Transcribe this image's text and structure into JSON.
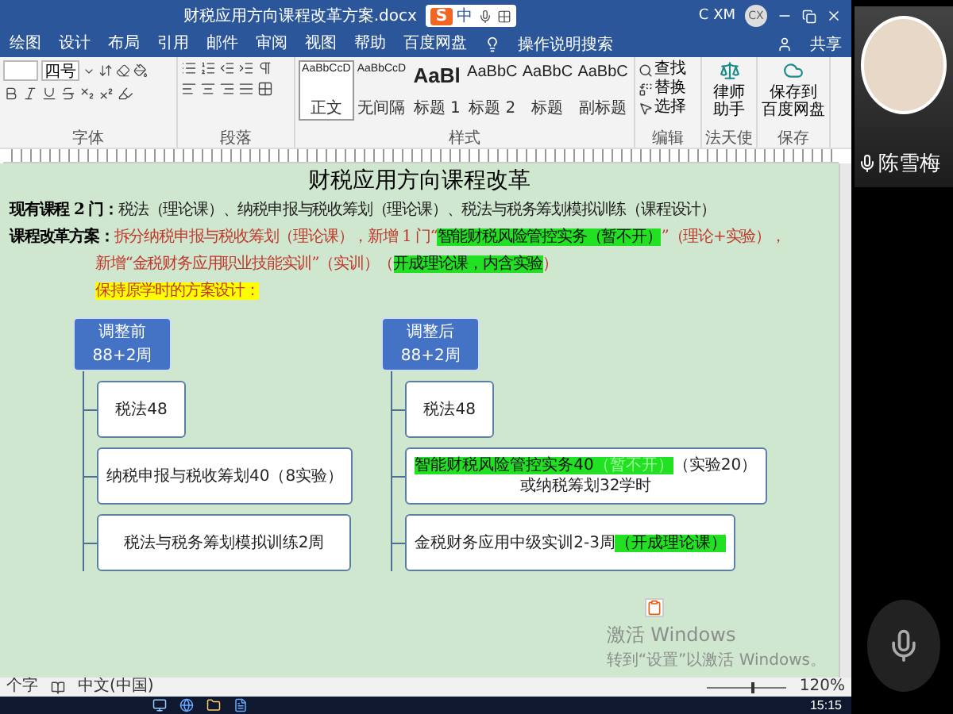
{
  "window": {
    "title": "财税应用方向课程改革方案.docx",
    "user": "C XM",
    "avatar": "CX"
  },
  "ime_toolbar": {
    "logo": "S",
    "mode": "中"
  },
  "menu": {
    "tabs": [
      {
        "label": "绘图",
        "selected": false
      },
      {
        "label": "设计",
        "selected": false
      },
      {
        "label": "布局",
        "selected": false
      },
      {
        "label": "引用",
        "selected": false
      },
      {
        "label": "邮件",
        "selected": false
      },
      {
        "label": "审阅",
        "selected": false
      },
      {
        "label": "视图",
        "selected": false
      },
      {
        "label": "帮助",
        "selected": false
      },
      {
        "label": "百度网盘",
        "selected": false
      }
    ],
    "search": "操作说明搜索",
    "share": "共享"
  },
  "ribbon": {
    "font_size": "四号",
    "group_labels": [
      "字体",
      "段落",
      "样式",
      "编辑",
      "法天使",
      "保存"
    ],
    "styles": [
      {
        "preview": "AaBbCcD",
        "name": "正文",
        "kind": "body",
        "selected": true
      },
      {
        "preview": "AaBbCcD",
        "name": "无间隔",
        "kind": "body",
        "selected": false
      },
      {
        "preview": "AaBl",
        "name": "标题 1",
        "kind": "title",
        "selected": false
      },
      {
        "preview": "AaBbC",
        "name": "标题 2",
        "kind": "heading",
        "selected": false
      },
      {
        "preview": "AaBbC",
        "name": "标题",
        "kind": "heading",
        "selected": false
      },
      {
        "preview": "AaBbC",
        "name": "副标题",
        "kind": "heading",
        "selected": false
      }
    ],
    "editing": [
      {
        "kind": "find",
        "label": "查找"
      },
      {
        "kind": "replace",
        "label": "替换"
      },
      {
        "kind": "select",
        "label": "选择"
      }
    ],
    "addins": [
      {
        "kind": "assistant",
        "lines": [
          "律师",
          "助手"
        ]
      },
      {
        "kind": "cloud",
        "lines": [
          "保存到",
          "百度网盘"
        ]
      }
    ]
  },
  "document": {
    "title": "财税应用方向课程改革",
    "paragraphs": [
      {
        "label": "现有课程 2 门：",
        "segments": [
          {
            "text": "税法（理论课）、纳税申报与税收筹划（理论课）、税法与税务筹划模拟训练（课程设计）",
            "kind": "normal"
          }
        ]
      },
      {
        "label": "课程改革方案：",
        "segments": [
          {
            "text": "拆分纳税申报与税收筹划（理论课），新增 1 门“",
            "kind": "red"
          },
          {
            "text": "智能财税风险管控实务（暂不开）",
            "kind": "green_highlight"
          },
          {
            "text": "”（理论+实验），",
            "kind": "red"
          }
        ]
      },
      {
        "segments": [
          {
            "text": "新增“金税财务应用职业技能实训”（实训）（",
            "kind": "red"
          },
          {
            "text": "开成理论课，内含实验",
            "kind": "green_highlight"
          },
          {
            "text": "）",
            "kind": "red"
          }
        ]
      },
      {
        "segments": [
          {
            "text": "保持原学时的方案设计：",
            "kind": "yellow_highlight"
          }
        ]
      }
    ]
  },
  "diagram": {
    "columns": [
      {
        "header": [
          "调整前",
          "88+2周"
        ],
        "items": [
          {
            "kind": "small",
            "lines": [
              [
                {
                  "text": "税法48",
                  "kind": "normal"
                }
              ]
            ]
          },
          {
            "kind": "wide",
            "lines": [
              [
                {
                  "text": "纳税申报与税收筹划40（8实验）",
                  "kind": "normal"
                }
              ]
            ]
          },
          {
            "kind": "wide",
            "lines": [
              [
                {
                  "text": "税法与税务筹划模拟训练2周",
                  "kind": "normal"
                }
              ]
            ]
          }
        ]
      },
      {
        "header": [
          "调整后",
          "88+2周"
        ],
        "items": [
          {
            "kind": "small",
            "lines": [
              [
                {
                  "text": "税法48",
                  "kind": "normal"
                }
              ]
            ]
          },
          {
            "kind": "wide",
            "lines": [
              [
                {
                  "text": "智能财税风险管控实务40",
                  "kind": "green_highlight"
                },
                {
                  "text": "（暂不开）",
                  "kind": "faint_green_highlight"
                },
                {
                  "text": "（实验20）",
                  "kind": "normal"
                }
              ],
              [
                {
                  "text": "或纳税筹划32学时",
                  "kind": "normal"
                }
              ]
            ]
          },
          {
            "kind": "wide",
            "lines": [
              [
                {
                  "text": "金税财务应用中级实训2-3周",
                  "kind": "normal"
                },
                {
                  "text": "（开成理论课）",
                  "kind": "green_highlight"
                }
              ]
            ]
          }
        ]
      }
    ]
  },
  "activation_notice": {
    "title": "激活 Windows",
    "hint": "转到“设置”以激活 Windows。"
  },
  "status_bar": {
    "words": "个字",
    "language": "中文(中国)",
    "zoom": "120%",
    "zoom_slider": {
      "level": 0.55
    }
  },
  "taskbar": {
    "time": "15:15"
  },
  "video": {
    "name": "陈雪梅",
    "mic_on": true
  }
}
